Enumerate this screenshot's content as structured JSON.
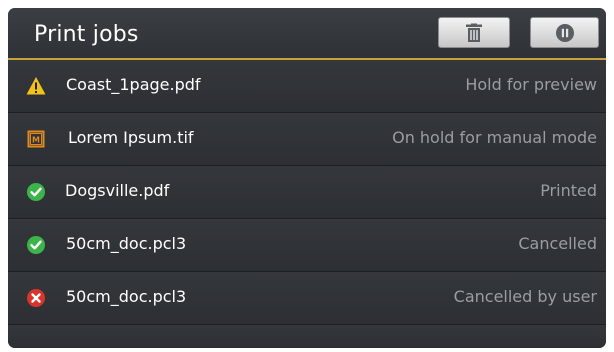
{
  "header": {
    "title": "Print jobs",
    "delete_button": {
      "icon": "trash-icon"
    },
    "pause_button": {
      "icon": "pause-icon"
    }
  },
  "jobs": [
    {
      "name": "Coast_1page.pdf",
      "status": "Hold for preview",
      "icon": "warning-icon",
      "icon_color": "#f2c21b"
    },
    {
      "name": "Lorem Ipsum.tif",
      "status": "On hold for manual mode",
      "icon": "manual-mode-icon",
      "icon_color": "#e08a1e"
    },
    {
      "name": "Dogsville.pdf",
      "status": "Printed",
      "icon": "check-circle-icon",
      "icon_color": "#3cb44a"
    },
    {
      "name": "50cm_doc.pcl3",
      "status": "Cancelled",
      "icon": "check-circle-icon",
      "icon_color": "#3cb44a"
    },
    {
      "name": "50cm_doc.pcl3",
      "status": "Cancelled by user",
      "icon": "error-circle-icon",
      "icon_color": "#d9342b"
    }
  ],
  "colors": {
    "accent_underline": "#c9a23c",
    "background": "#2b2e32",
    "status_text": "#9a9da1"
  }
}
